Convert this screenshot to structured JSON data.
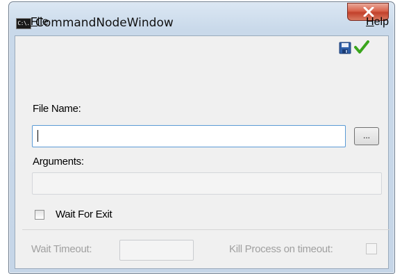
{
  "window": {
    "title": "CommandNodeWindow",
    "icon": "C:\\.",
    "close_label": "x"
  },
  "menu": {
    "file": {
      "accel": "F",
      "rest": "ile"
    },
    "help": {
      "accel": "H",
      "rest": "elp"
    }
  },
  "toolbar": {
    "save_icon": "floppy-disk",
    "apply_icon": "green-checkmark"
  },
  "form": {
    "file_name_label": "File Name:",
    "file_name_value": "",
    "browse_label": "...",
    "arguments_label": "Arguments:",
    "arguments_value": "",
    "wait_for_exit_label": "Wait For Exit",
    "wait_for_exit_checked": false,
    "wait_timeout_label": "Wait Timeout:",
    "wait_timeout_value": "",
    "kill_process_label": "Kill Process on timeout:",
    "kill_process_checked": false
  },
  "colors": {
    "frame": "#c9d9ea",
    "close": "#c2412b",
    "check": "#3aa51c",
    "disabled_text": "#a0a0a0"
  }
}
